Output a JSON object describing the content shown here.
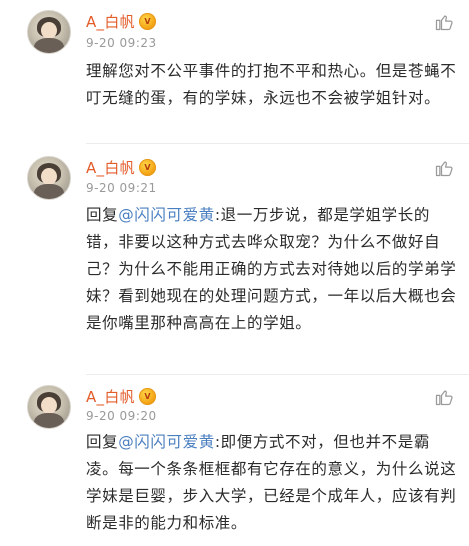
{
  "comments": [
    {
      "username": "A_白帆",
      "badge": "V",
      "timestamp": "9-20 09:23",
      "text": "理解您对不公平事件的打抱不平和热心。但是苍蝇不叮无缝的蛋，有的学妹，永远也不会被学姐针对。"
    },
    {
      "username": "A_白帆",
      "badge": "V",
      "timestamp": "9-20 09:21",
      "reply_prefix": "回复",
      "mention": "@闪闪可爱黄",
      "text": ":退一万步说，都是学姐学长的错，非要以这种方式去哗众取宠？为什么不做好自己？为什么不能用正确的方式去对待她以后的学弟学妹？看到她现在的处理问题方式，一年以后大概也会是你嘴里那种高高在上的学姐。"
    },
    {
      "username": "A_白帆",
      "badge": "V",
      "timestamp": "9-20 09:20",
      "reply_prefix": "回复",
      "mention": "@闪闪可爱黄",
      "text": ":即便方式不对，但也并不是霸凌。每一个条条框框都有它存在的意义，为什么说这学妹是巨婴，步入大学，已经是个成年人，应该有判断是非的能力和标准。"
    }
  ],
  "icons": {
    "like": "thumbs-up-icon",
    "avatar": "user-avatar"
  },
  "colors": {
    "username": "#e35c2a",
    "mention": "#4a7fc0",
    "timestamp": "#999999",
    "text": "#2b2b2b"
  }
}
